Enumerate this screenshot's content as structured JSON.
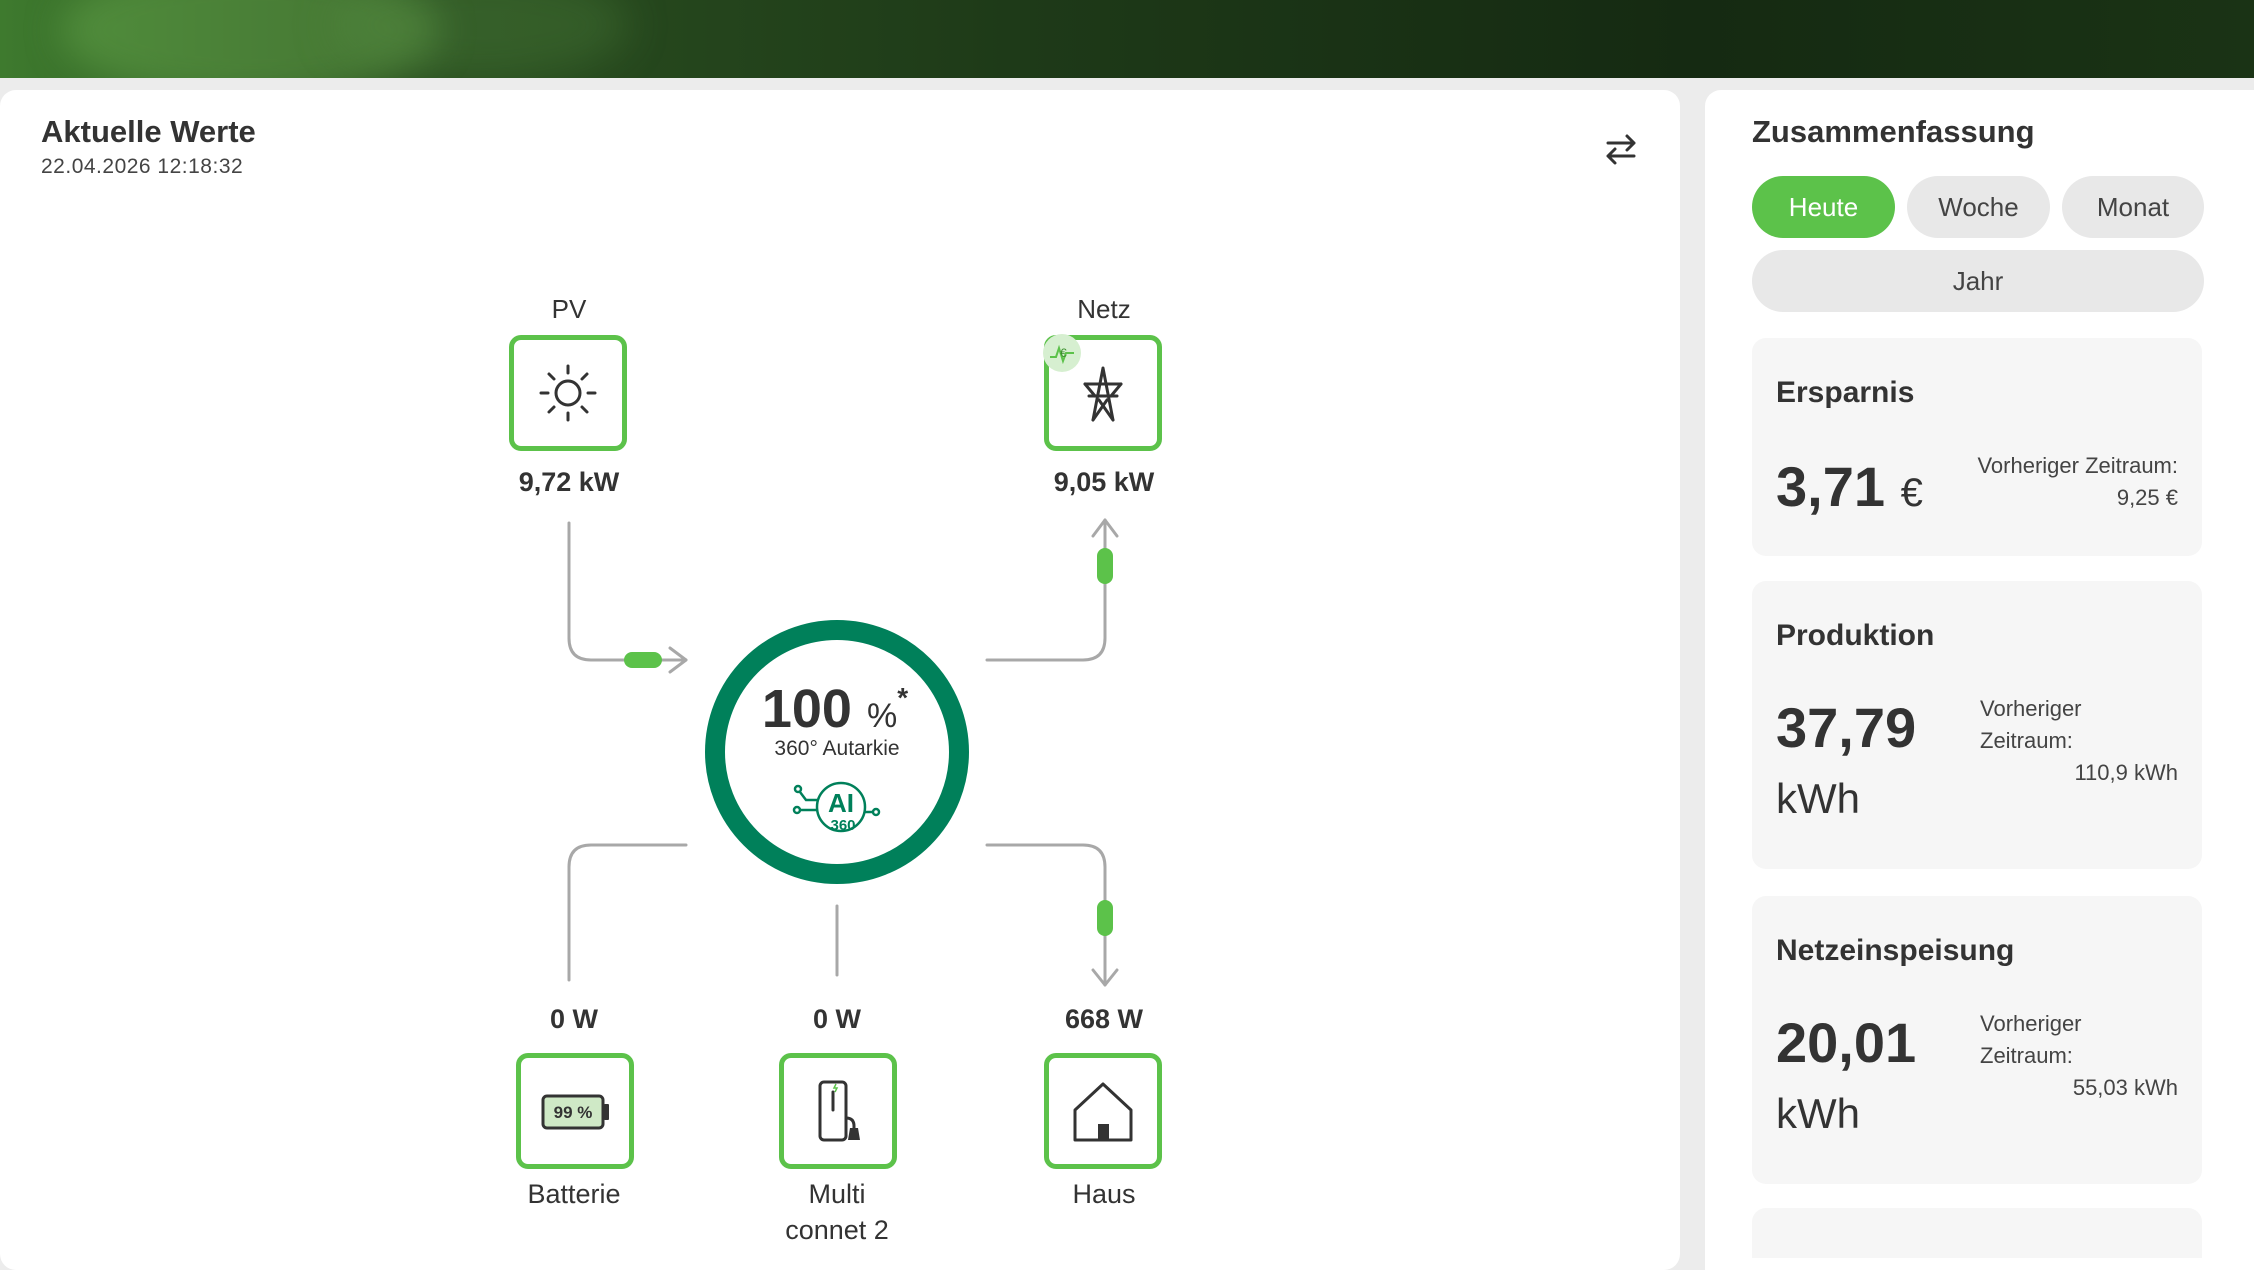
{
  "current": {
    "title": "Aktuelle Werte",
    "timestamp": "22.04.2026 12:18:32"
  },
  "nodes": {
    "pv": {
      "label": "PV",
      "value": "9,72 kW"
    },
    "grid": {
      "label": "Netz",
      "value": "9,05 kW"
    },
    "battery": {
      "value": "0 W",
      "name": "Batterie",
      "soc": "99 %"
    },
    "wallbox": {
      "value": "0 W",
      "name_line1": "Multi",
      "name_line2": "connet 2"
    },
    "house": {
      "value": "668 W",
      "name": "Haus"
    }
  },
  "autarky": {
    "value": "100",
    "unit": "%",
    "star": "*",
    "label": "360° Autarkie",
    "badge_text": "AI",
    "badge_sub": "360"
  },
  "summary": {
    "title": "Zusammenfassung",
    "periods": [
      "Heute",
      "Woche",
      "Monat",
      "Jahr"
    ],
    "active_period": "Heute",
    "savings": {
      "title": "Ersparnis",
      "value": "3,71",
      "unit": "€",
      "prev_label": "Vorheriger Zeitraum:",
      "prev_value": "9,25 €"
    },
    "production": {
      "title": "Produktion",
      "value": "37,79",
      "unit": "kWh",
      "prev_label_line1": "Vorheriger",
      "prev_label_line2": "Zeitraum:",
      "prev_value": "110,9 kWh"
    },
    "feed_in": {
      "title": "Netzeinspeisung",
      "value": "20,01",
      "unit": "kWh",
      "prev_label_line1": "Vorheriger",
      "prev_label_line2": "Zeitraum:",
      "prev_value": "55,03 kWh"
    }
  },
  "colors": {
    "accent": "#5cc24a",
    "ring": "#00805a",
    "line": "#a8a8a8"
  }
}
